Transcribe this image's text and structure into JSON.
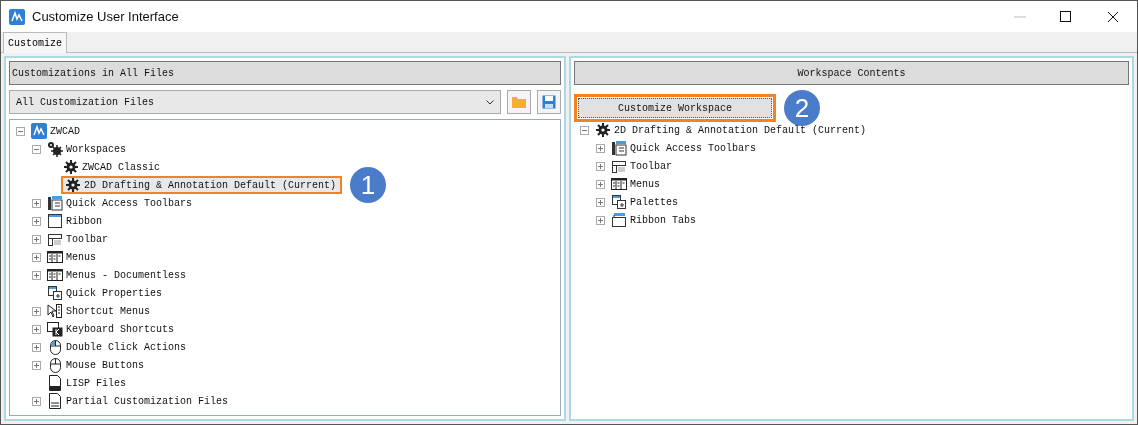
{
  "window": {
    "title": "Customize User Interface"
  },
  "tabs": [
    {
      "label": "Customize",
      "selected": true
    }
  ],
  "left_panel": {
    "header": "Customizations in All Files",
    "file_select": {
      "value": "All Customization Files"
    },
    "tree": [
      {
        "label": "ZWCAD",
        "kind": "logo",
        "expanded": true,
        "highlighted": false,
        "children": [
          {
            "label": "Workspaces",
            "kind": "gears",
            "expanded": true,
            "highlighted": false,
            "children": [
              {
                "label": "ZWCAD Classic",
                "kind": "gear",
                "highlighted": false
              },
              {
                "label": "2D Drafting & Annotation Default (Current)",
                "kind": "gear",
                "highlighted": true,
                "callout": "1"
              }
            ]
          },
          {
            "label": "Quick Access Toolbars",
            "kind": "qat",
            "expanded": false,
            "highlighted": false
          },
          {
            "label": "Ribbon",
            "kind": "ribbon",
            "expanded": false,
            "highlighted": false
          },
          {
            "label": "Toolbar",
            "kind": "toolbar",
            "expanded": false,
            "highlighted": false
          },
          {
            "label": "Menus",
            "kind": "menus",
            "expanded": false,
            "highlighted": false
          },
          {
            "label": "Menus - Documentless",
            "kind": "menus",
            "expanded": false,
            "highlighted": false
          },
          {
            "label": "Quick Properties",
            "kind": "properties",
            "highlighted": false
          },
          {
            "label": "Shortcut Menus",
            "kind": "shortcut",
            "expanded": false,
            "highlighted": false
          },
          {
            "label": "Keyboard Shortcuts",
            "kind": "keyboard",
            "expanded": false,
            "highlighted": false
          },
          {
            "label": "Double Click Actions",
            "kind": "dblclick",
            "expanded": false,
            "highlighted": false
          },
          {
            "label": "Mouse Buttons",
            "kind": "mouse",
            "expanded": false,
            "highlighted": false
          },
          {
            "label": "LISP Files",
            "kind": "lisp",
            "highlighted": false
          },
          {
            "label": "Partial Customization Files",
            "kind": "cui",
            "expanded": false,
            "highlighted": false
          }
        ]
      }
    ]
  },
  "right_panel": {
    "header": "Workspace Contents",
    "button": {
      "label": "Customize Workspace",
      "callout": "2"
    },
    "tree": [
      {
        "label": "2D Drafting & Annotation Default (Current)",
        "kind": "gear",
        "expanded": true,
        "highlighted": false,
        "children": [
          {
            "label": "Quick Access Toolbars",
            "kind": "qat",
            "expanded": false,
            "highlighted": false
          },
          {
            "label": "Toolbar",
            "kind": "toolbar",
            "expanded": false,
            "highlighted": false
          },
          {
            "label": "Menus",
            "kind": "menus",
            "expanded": false,
            "highlighted": false
          },
          {
            "label": "Palettes",
            "kind": "properties",
            "expanded": false,
            "highlighted": false
          },
          {
            "label": "Ribbon Tabs",
            "kind": "ribbontabs",
            "expanded": false,
            "highlighted": false
          }
        ]
      }
    ]
  }
}
